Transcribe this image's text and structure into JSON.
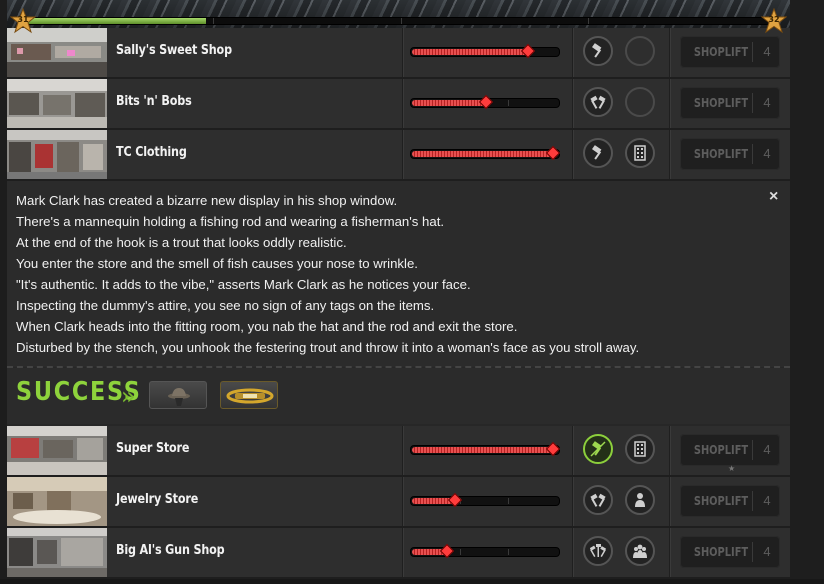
{
  "level": {
    "current": "31",
    "next": "32",
    "progress_fraction": 0.24
  },
  "crimes_top": [
    {
      "name": "Sally's Sweet Shop",
      "progress": 0.82,
      "button": "SHOPLIFT",
      "nerve": "4"
    },
    {
      "name": "Bits 'n' Bobs",
      "progress": 0.52,
      "button": "SHOPLIFT",
      "nerve": "4"
    },
    {
      "name": "TC Clothing",
      "progress": 1.0,
      "button": "SHOPLIFT",
      "nerve": "4"
    }
  ],
  "story": {
    "lines": [
      "Mark Clark has created a bizarre new display in his shop window.",
      "There's a mannequin holding a fishing rod and wearing a fisherman's hat.",
      "At the end of the hook is a trout that looks oddly realistic.",
      "You enter the store and the smell of fish causes your nose to wrinkle.",
      "\"It's authentic. It adds to the vibe,\" asserts Mark Clark as he notices your face.",
      "Inspecting the dummy's attire, you see no sign of any tags on the items.",
      "When Clark heads into the fitting room, you nab the hat and the rod and exit the store.",
      "Disturbed by the stench, you unhook the festering trout and throw it into a woman's face as you stroll away."
    ],
    "close": "×"
  },
  "result": {
    "label": "SUCCESS",
    "arrow": "»",
    "items": [
      "fisherman-hat",
      "fishing-rod"
    ]
  },
  "crimes_bottom": [
    {
      "name": "Super Store",
      "progress": 1.0,
      "button": "SHOPLIFT",
      "nerve": "4",
      "mini": "★"
    },
    {
      "name": "Jewelry Store",
      "progress": 0.3,
      "button": "SHOPLIFT",
      "nerve": "4"
    },
    {
      "name": "Big Al's Gun Shop",
      "progress": 0.24,
      "button": "SHOPLIFT",
      "nerve": "4"
    }
  ],
  "colors": {
    "success": "#8ed33c",
    "progress": "#e85050",
    "xp": "#a6d96a"
  }
}
